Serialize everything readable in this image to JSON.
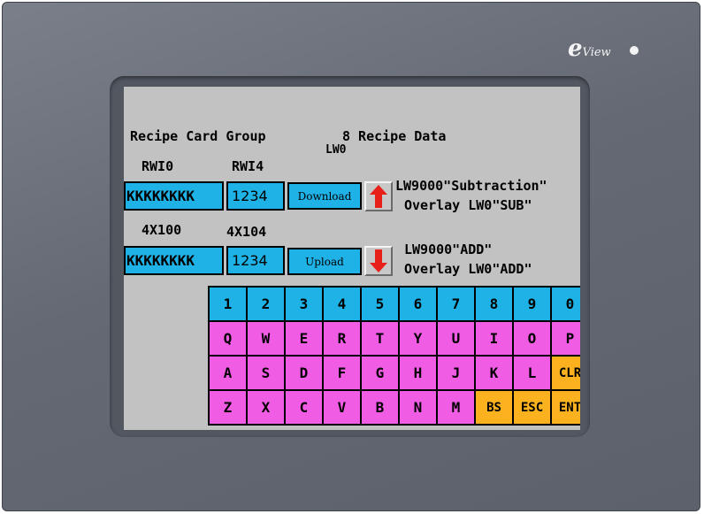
{
  "brand": {
    "logo_letter": "e",
    "logo_word": "View"
  },
  "recipe": {
    "group_label": "Recipe Card Group",
    "data_label": "8 Recipe Data",
    "lw0_label": "LW0",
    "rwi0_label": "RWI0",
    "rwi4_label": "RWI4",
    "row1_text": "KKKKKKKK",
    "row1_num": "1234",
    "download_label": "Download",
    "note1_line1": "LW9000\"Subtraction\"",
    "note1_line2": "Overlay LW0\"SUB\"",
    "x100_label": "4X100",
    "x104_label": "4X104",
    "row2_text": "KKKKKKKK",
    "row2_num": "1234",
    "upload_label": "Upload",
    "note2_line1": "LW9000\"ADD\"",
    "note2_line2": "Overlay LW0\"ADD\""
  },
  "icons": {
    "up": "up-arrow-icon",
    "down": "down-arrow-icon"
  },
  "keypad": {
    "row1": [
      "1",
      "2",
      "3",
      "4",
      "5",
      "6",
      "7",
      "8",
      "9",
      "0"
    ],
    "row2": [
      "Q",
      "W",
      "E",
      "R",
      "T",
      "Y",
      "U",
      "I",
      "O",
      "P"
    ],
    "row3": [
      "A",
      "S",
      "D",
      "F",
      "G",
      "H",
      "J",
      "K",
      "L",
      "CLR"
    ],
    "row4": [
      "Z",
      "X",
      "C",
      "V",
      "B",
      "N",
      "M",
      "BS",
      "ESC",
      "ENT"
    ]
  },
  "colors": {
    "bezel": "#646973",
    "screen": "#c2c2c2",
    "number_keys": "#1fb2e6",
    "letter_keys": "#f05ce4",
    "function_keys": "#fbb21e",
    "arrow": "#e8201a"
  }
}
